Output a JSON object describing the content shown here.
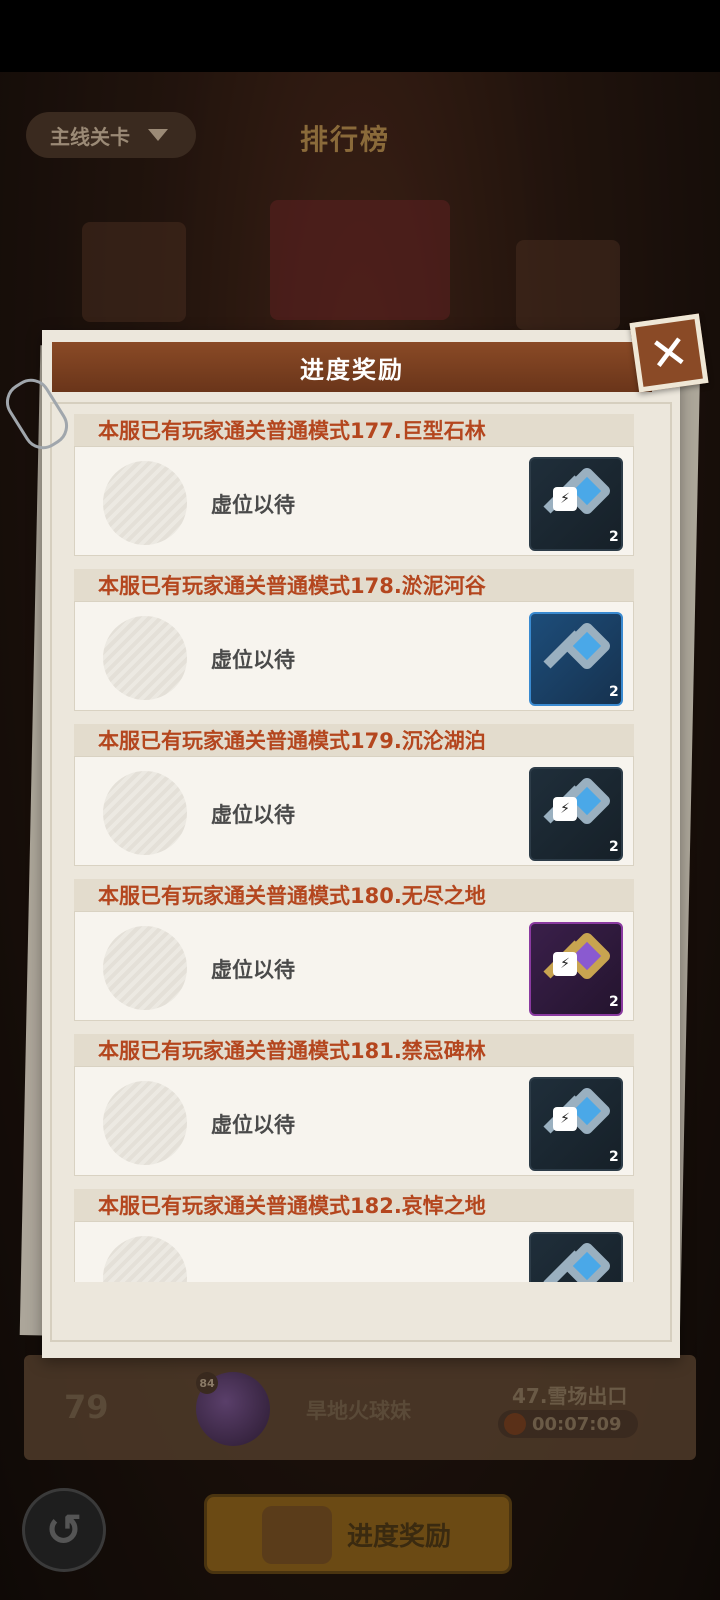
{
  "background": {
    "mode_selector": "主线关卡",
    "title": "排行榜",
    "bottom_entry": {
      "rank": "79",
      "level": "84",
      "player_name": "旱地火球妹",
      "stage": "47.雪场出口",
      "time": "00:07:09"
    },
    "reward_button_label": "进度奖励"
  },
  "modal": {
    "title": "进度奖励",
    "rows": [
      {
        "title": "本服已有玩家通关普通模式177.巨型石林",
        "status": "虚位以待",
        "reward_icon": "lightning-key-icon",
        "count": "2",
        "locked": true
      },
      {
        "title": "本服已有玩家通关普通模式178.淤泥河谷",
        "status": "虚位以待",
        "reward_icon": "blue-key-icon",
        "count": "2",
        "locked": false
      },
      {
        "title": "本服已有玩家通关普通模式179.沉沦湖泊",
        "status": "虚位以待",
        "reward_icon": "lightning-key-icon",
        "count": "2",
        "locked": true
      },
      {
        "title": "本服已有玩家通关普通模式180.无尽之地",
        "status": "虚位以待",
        "reward_icon": "purple-key-icon",
        "count": "2",
        "locked": true
      },
      {
        "title": "本服已有玩家通关普通模式181.禁忌碑林",
        "status": "虚位以待",
        "reward_icon": "lightning-key-icon",
        "count": "2",
        "locked": true
      },
      {
        "title": "本服已有玩家通关普通模式182.哀悼之地",
        "status": "",
        "reward_icon": "lightning-key-icon",
        "count": "",
        "locked": true
      }
    ]
  },
  "colors": {
    "header_brown": "#7a3f20",
    "row_title_text": "#b4461e",
    "paper": "#ece7dc"
  }
}
